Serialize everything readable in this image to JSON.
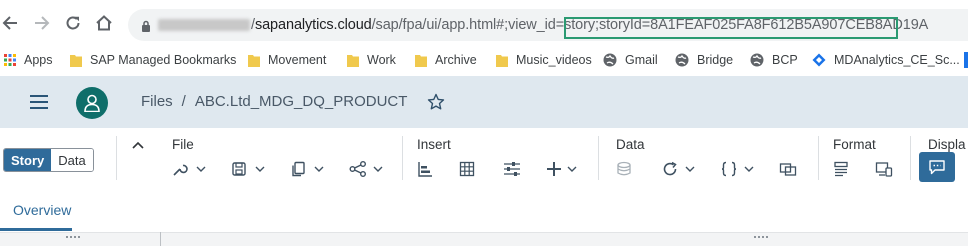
{
  "browser": {
    "url_prefix": "/sapanalytics.cloud/sap/fpa/ui/app.html#;view_id=story;",
    "url_highlight": "storyId=8A1FEAF025FA8F612B5A907CEB8AD19A",
    "url_host": "sapanalytics.cloud"
  },
  "bookmarks": [
    {
      "label": "Apps",
      "icon": "apps-grid-icon"
    },
    {
      "label": "SAP Managed Bookmarks",
      "icon": "folder-icon"
    },
    {
      "label": "Movement",
      "icon": "folder-icon"
    },
    {
      "label": "Work",
      "icon": "folder-icon"
    },
    {
      "label": "Archive",
      "icon": "folder-icon"
    },
    {
      "label": "Music_videos",
      "icon": "folder-icon"
    },
    {
      "label": "Gmail",
      "icon": "globe-icon"
    },
    {
      "label": "Bridge",
      "icon": "globe-icon"
    },
    {
      "label": "BCP",
      "icon": "globe-icon"
    },
    {
      "label": "MDAnalytics_CE_Sc...",
      "icon": "diamond-icon"
    }
  ],
  "shell": {
    "breadcrumb_root": "Files",
    "breadcrumb_sep": "/",
    "breadcrumb_current": "ABC.Ltd_MDG_DQ_PRODUCT"
  },
  "toolbar": {
    "mode_story": "Story",
    "mode_data": "Data",
    "groups": {
      "file": "File",
      "insert": "Insert",
      "data": "Data",
      "format": "Format",
      "display": "Displa"
    }
  },
  "tabs": {
    "overview": "Overview"
  },
  "colors": {
    "shell_bg": "#dfe8ef",
    "accent": "#2f6b9a",
    "highlight_box": "#2b9a72",
    "avatar": "#0f6e6a"
  }
}
